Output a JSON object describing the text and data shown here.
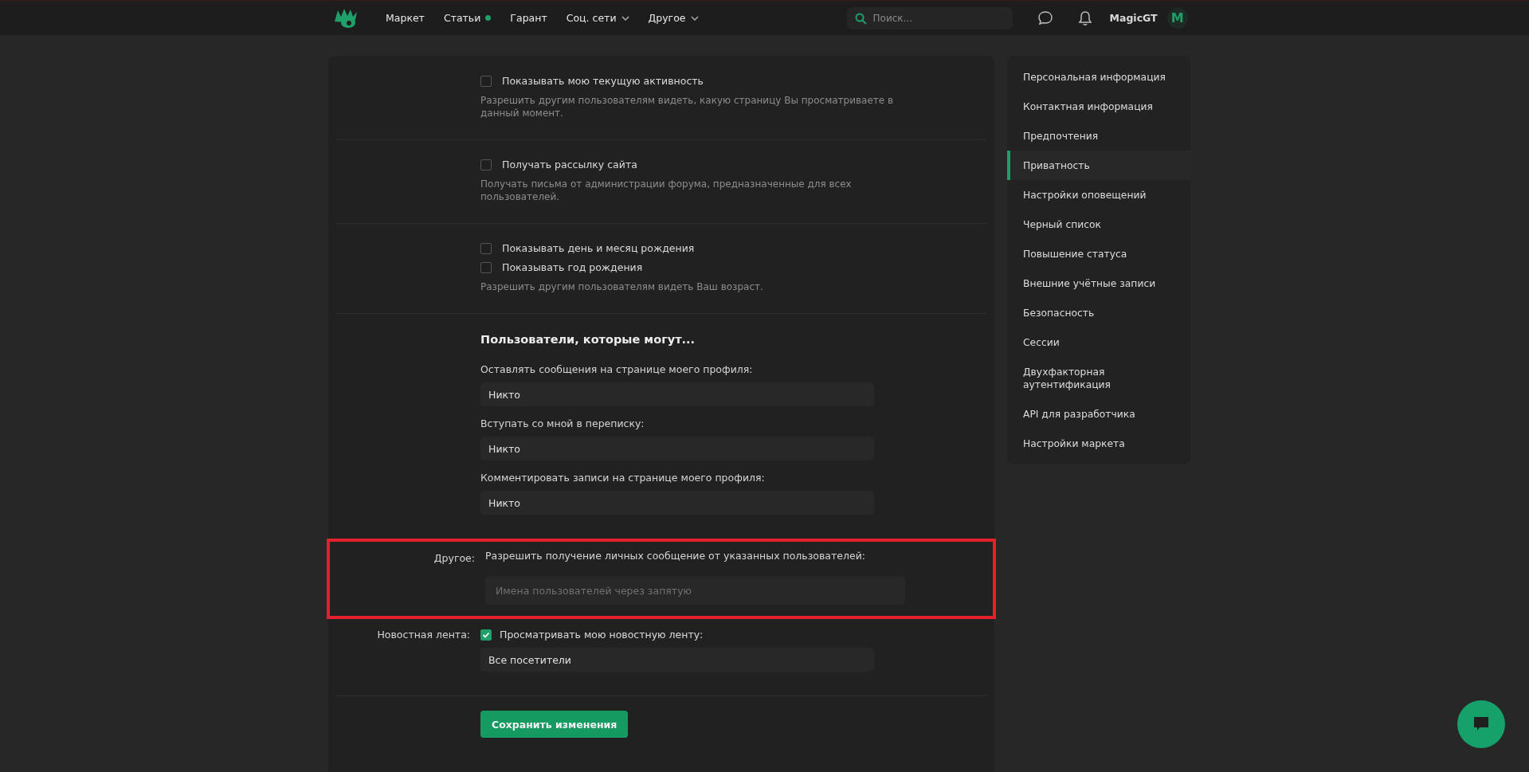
{
  "header": {
    "nav": [
      {
        "label": "Маркет",
        "kind": "plain"
      },
      {
        "label": "Статьи",
        "kind": "dot"
      },
      {
        "label": "Гарант",
        "kind": "plain"
      },
      {
        "label": "Соц. сети",
        "kind": "menu"
      },
      {
        "label": "Другое",
        "kind": "menu"
      }
    ],
    "search": {
      "placeholder": "Поиск..."
    },
    "username": "MagicGT",
    "avatar_letter": "M"
  },
  "sections": [
    {
      "kind": "checks",
      "checks": [
        {
          "label": "Показывать мою текущую активность",
          "checked": false
        }
      ],
      "hint": "Разрешить другим пользователям видеть, какую страницу Вы просматриваете в данный момент."
    },
    {
      "kind": "checks",
      "checks": [
        {
          "label": "Получать рассылку сайта",
          "checked": false
        }
      ],
      "hint": "Получать письма от администрации форума, предназначенные для всех пользователей."
    },
    {
      "kind": "checks",
      "checks": [
        {
          "label": "Показывать день и месяц рождения",
          "checked": false
        },
        {
          "label": "Показывать год рождения",
          "checked": false
        }
      ],
      "hint": "Разрешить другим пользователям видеть Ваш возраст."
    },
    {
      "kind": "selects",
      "title": "Пользователи, которые могут...",
      "fields": [
        {
          "label": "Оставлять сообщения на странице моего профиля:",
          "value": "Никто"
        },
        {
          "label": "Вступать со мной в переписку:",
          "value": "Никто"
        },
        {
          "label": "Комментировать записи на странице моего профиля:",
          "value": "Никто"
        }
      ]
    }
  ],
  "other": {
    "row_label": "Другое:",
    "label": "Разрешить получение личных сообщение от указанных пользователей:",
    "placeholder": "Имена пользователей через запятую",
    "highlighted": true
  },
  "news_feed": {
    "row_label": "Новостная лента:",
    "checkbox": {
      "label": "Просматривать мою новостную ленту:",
      "checked": true
    },
    "value": "Все посетители"
  },
  "save_button": "Сохранить изменения",
  "sidebar": {
    "items": [
      {
        "label": "Персональная информация",
        "selected": false
      },
      {
        "label": "Контактная информация",
        "selected": false
      },
      {
        "label": "Предпочтения",
        "selected": false
      },
      {
        "label": "Приватность",
        "selected": true
      },
      {
        "label": "Настройки оповещений",
        "selected": false
      },
      {
        "label": "Черный список",
        "selected": false
      },
      {
        "label": "Повышение статуса",
        "selected": false
      },
      {
        "label": "Внешние учётные записи",
        "selected": false
      },
      {
        "label": "Безопасность",
        "selected": false
      },
      {
        "label": "Сессии",
        "selected": false
      },
      {
        "label": "Двухфакторная аутентификация",
        "selected": false
      },
      {
        "label": "API для разработчика",
        "selected": false
      },
      {
        "label": "Настройки маркета",
        "selected": false
      }
    ]
  }
}
